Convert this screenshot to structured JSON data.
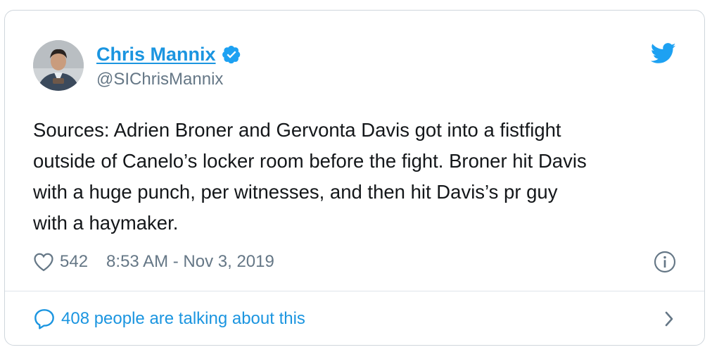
{
  "author": {
    "display_name": "Chris Mannix",
    "handle": "@SIChrisMannix",
    "verified": true
  },
  "icons": {
    "avatar": "author-photo",
    "verified": "verified-badge-icon",
    "logo": "twitter-bird-icon",
    "like": "heart-icon",
    "info": "info-icon",
    "reply": "speech-bubble-icon",
    "chevron": "chevron-right-icon"
  },
  "tweet": {
    "lines": [
      "Sources: Adrien Broner and Gervonta Davis got into a fistfight",
      "outside of Canelo’s locker room before the fight. Broner hit Davis",
      "with a huge punch, per witnesses, and then hit Davis’s pr guy",
      "with a haymaker."
    ]
  },
  "meta": {
    "likes": "542",
    "timestamp": "8:53 AM - Nov 3, 2019"
  },
  "footer": {
    "talking": "408 people are talking about this"
  },
  "colors": {
    "accent": "#1b95e0",
    "muted": "#657786",
    "text": "#14171a",
    "border": "#cfd6dc"
  }
}
